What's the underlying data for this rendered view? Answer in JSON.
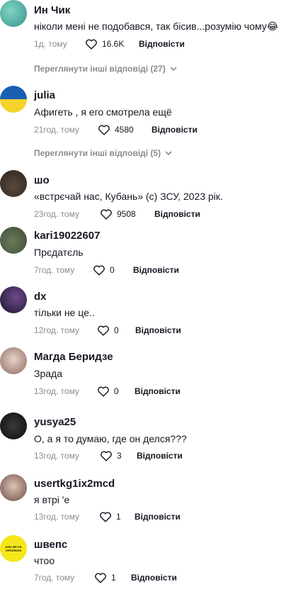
{
  "comments": [
    {
      "name": "Ин Чик",
      "text": "ніколи мені не подобався, так бісив...розумію чому😂",
      "time": "1д. тому",
      "likes": "16.6K",
      "reply": "Відповісти"
    },
    {
      "name": "julia",
      "text": "Афигеть , я его смотрела ещё",
      "time": "21год. тому",
      "likes": "4580",
      "reply": "Відповісти"
    },
    {
      "name": "шо",
      "text": "«встрєчай нас, Кубань» (с) ЗСУ, 2023 рік.",
      "time": "23год. тому",
      "likes": "9508",
      "reply": "Відповісти"
    },
    {
      "name": "kari19022607",
      "text": "Прєдатєль",
      "time": "7год. тому",
      "likes": "0",
      "reply": "Відповісти"
    },
    {
      "name": "dx",
      "text": "тільки не це..",
      "time": "12год. тому",
      "likes": "0",
      "reply": "Відповісти"
    },
    {
      "name": "Магда Беридзе",
      "text": "Зрада",
      "time": "13год. тому",
      "likes": "0",
      "reply": "Відповісти"
    },
    {
      "name": "yusya25",
      "text": "О, а я то думаю, где он делся???",
      "time": "13год. тому",
      "likes": "3",
      "reply": "Відповісти"
    },
    {
      "name": "usertkg1ix2mcd",
      "text": "я втрі   'е",
      "time": "13год. тому",
      "likes": "1",
      "reply": "Відповісти"
    },
    {
      "name": "швепс",
      "text": "чтоо",
      "time": "7год. тому",
      "likes": "1",
      "reply": "Відповісти"
    }
  ],
  "more_replies": [
    {
      "label": "Переглянути інші відповіді (27)"
    },
    {
      "label": "Переглянути інші відповіді (5)"
    }
  ],
  "avatar_badge_text": "KISS ME I'M UKRAINIAN",
  "colors": {
    "like_icon": "#161823",
    "meta_grey": "#8a8b91",
    "ukraine_blue": "#1a5fb4",
    "ukraine_yellow": "#f6d32d"
  }
}
